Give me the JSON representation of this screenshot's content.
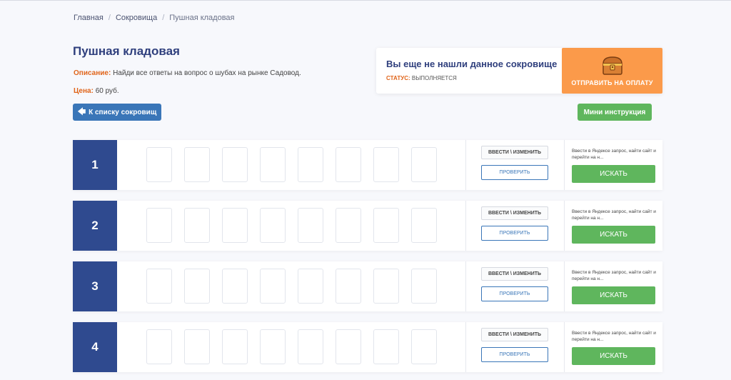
{
  "breadcrumb": {
    "home": "Главная",
    "section": "Сокровища",
    "current": "Пушная кладовая",
    "separator": "/"
  },
  "page": {
    "title": "Пушная кладовая",
    "description_label": "Описание:",
    "description_text": "Найди все ответы на вопрос о шубах на рынке Садовод.",
    "price_label": "Цена:",
    "price_value": "60 руб."
  },
  "buttons": {
    "back": "К списку сокровищ",
    "back_icon": "arrow-left-icon",
    "mini": "Мини инструкция"
  },
  "status_card": {
    "title": "Вы еще не нашли данное сокровище",
    "status_label": "СТАТУС:",
    "status_value": "ВЫПОЛНЯЕТСЯ",
    "pay_label": "ОТПРАВИТЬ НА ОПЛАТУ",
    "pay_icon": "treasure-chest-icon"
  },
  "rows": [
    {
      "number": "1",
      "enter_label": "ВВЕСТИ \\ ИЗМЕНИТЬ",
      "check_label": "ПРОВЕРИТЬ",
      "hint": "Ввести в Яндексе запрос, найти сайт и перейти на н...",
      "search_label": "ИСКАТЬ"
    },
    {
      "number": "2",
      "enter_label": "ВВЕСТИ \\ ИЗМЕНИТЬ",
      "check_label": "ПРОВЕРИТЬ",
      "hint": "Ввести в Яндексе запрос, найти сайт и перейти на н...",
      "search_label": "ИСКАТЬ"
    },
    {
      "number": "3",
      "enter_label": "ВВЕСТИ \\ ИЗМЕНИТЬ",
      "check_label": "ПРОВЕРИТЬ",
      "hint": "Ввести в Яндексе запрос, найти сайт и перейти на н...",
      "search_label": "ИСКАТЬ"
    },
    {
      "number": "4",
      "enter_label": "ВВЕСТИ \\ ИЗМЕНИТЬ",
      "check_label": "ПРОВЕРИТЬ",
      "hint": "Ввести в Яндексе запрос, найти сайт и перейти на н...",
      "search_label": "ИСКАТЬ"
    }
  ],
  "colors": {
    "primary_blue": "#3a76b8",
    "number_block": "#2f4a8f",
    "green": "#5fb65d",
    "orange": "#fb9a4a",
    "accent_orange": "#e0651b"
  }
}
